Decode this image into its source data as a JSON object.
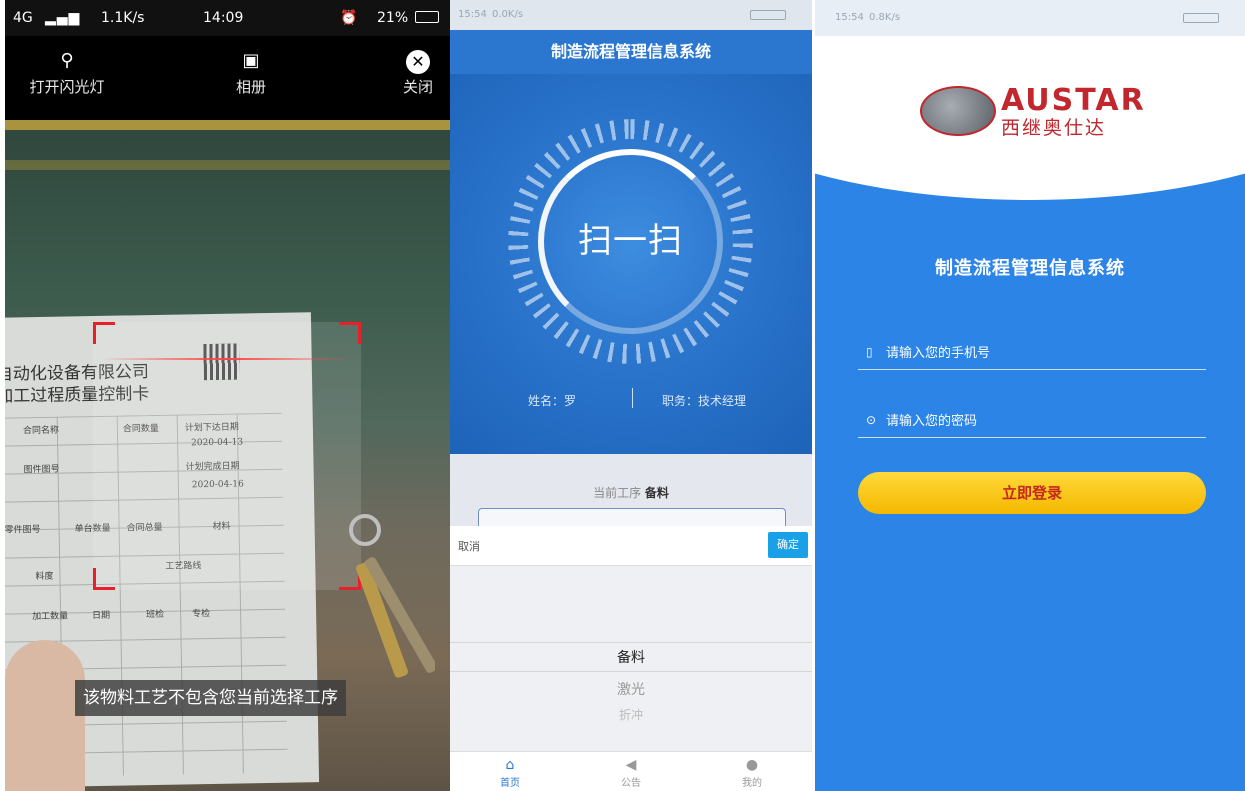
{
  "scanner": {
    "status": {
      "signal": "4G",
      "speed": "1.1K/s",
      "time": "14:09",
      "battery": "21%"
    },
    "flashlight_label": "打开闪光灯",
    "album_label": "相册",
    "close_label": "关闭",
    "document": {
      "company_line": "自动化设备有限公司",
      "card_title": "加工过程质量控制卡",
      "cells": [
        "合同名称",
        "合同数量",
        "计划下达日期",
        "2020-04-13",
        "图件图号",
        "计划完成日期",
        "2020-04-16",
        "零件图号",
        "单台数量",
        "合同总量",
        "材料",
        "工艺路线",
        "料度",
        "加工数量",
        "日期",
        "班检",
        "专检"
      ]
    },
    "toast": "该物料工艺不包含您当前选择工序"
  },
  "scan_home": {
    "status": {
      "time": "15:54",
      "speed": "0.0K/s"
    },
    "title": "制造流程管理信息系统",
    "scan_button": "扫一扫",
    "user_name": "姓名：罗",
    "user_role": "职务：技术经理",
    "current_process_label": "当前工序",
    "current_process_value": "备料",
    "cancel_label": "取消",
    "confirm_label": "确定",
    "picker_options": [
      "备料",
      "激光",
      "折冲"
    ],
    "tabs": [
      {
        "label": "首页",
        "icon": "home-icon"
      },
      {
        "label": "公告",
        "icon": "megaphone-icon"
      },
      {
        "label": "我的",
        "icon": "user-icon"
      }
    ]
  },
  "login": {
    "status": {
      "time": "15:54",
      "speed": "0.8K/s"
    },
    "brand": "AUSTAR",
    "brand_cn": "西继奥仕达",
    "title": "制造流程管理信息系统",
    "phone_placeholder": "请输入您的手机号",
    "password_placeholder": "请输入您的密码",
    "login_label": "立即登录"
  }
}
